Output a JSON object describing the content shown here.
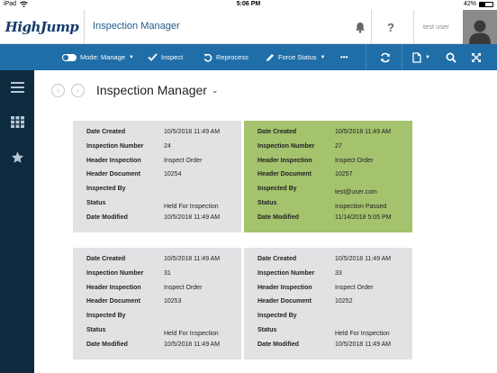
{
  "status_bar": {
    "device": "iPad",
    "time": "5:06 PM",
    "battery": "42%",
    "battery_level": 0.42
  },
  "header": {
    "logo": "HighJump",
    "title": "Inspection Manager",
    "username": "test user",
    "icons": {
      "notifications": "bell-icon",
      "help": "question-icon",
      "user": "avatar-icon"
    }
  },
  "toolbar": {
    "mode_label": "Mode: Manage",
    "inspect_label": "Inspect",
    "reprocess_label": "Reprocess",
    "force_status_label": "Force Status",
    "more_label": "•••",
    "accent_color": "#1f6ea8"
  },
  "main": {
    "page_title": "Inspection Manager",
    "labels": {
      "date_created": "Date Created",
      "inspection_number": "Inspection Number",
      "header_inspection": "Header Inspection",
      "header_document": "Header Document",
      "inspected_by": "Inspected By",
      "status": "Status",
      "date_modified": "Date Modified"
    },
    "cards": [
      {
        "date_created": "10/5/2018 11:49 AM",
        "inspection_number": "24",
        "header_inspection": "Inspect Order",
        "header_document": "10254",
        "inspected_by": "",
        "status": "Held For Inspection",
        "date_modified": "10/5/2018 11:49 AM",
        "color": "#e1e2e4"
      },
      {
        "date_created": "10/5/2018 11:49 AM",
        "inspection_number": "27",
        "header_inspection": "Inspect Order",
        "header_document": "10257",
        "inspected_by": "test@user.com",
        "status": "Inspection Passed",
        "date_modified": "11/14/2018 5:05 PM",
        "color": "#a5c26d"
      },
      {
        "date_created": "10/5/2018 11:49 AM",
        "inspection_number": "31",
        "header_inspection": "Inspect Order",
        "header_document": "10253",
        "inspected_by": "",
        "status": "Held For Inspection",
        "date_modified": "10/5/2018 11:49 AM",
        "color": "#e1e2e4"
      },
      {
        "date_created": "10/5/2018 11:49 AM",
        "inspection_number": "33",
        "header_inspection": "Inspect Order",
        "header_document": "10252",
        "inspected_by": "",
        "status": "Held For Inspection",
        "date_modified": "10/5/2018 11:49 AM",
        "color": "#e1e2e4"
      }
    ]
  }
}
